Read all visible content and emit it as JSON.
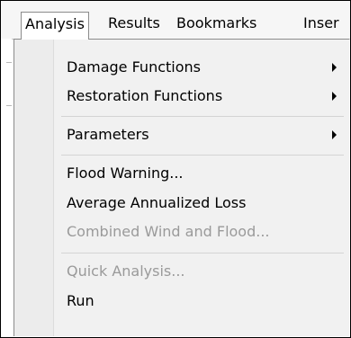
{
  "menubar": {
    "items": [
      {
        "label": "Analysis"
      },
      {
        "label": "Results"
      },
      {
        "label": "Bookmarks"
      },
      {
        "label": "Inser"
      }
    ]
  },
  "dropdown": {
    "items": [
      {
        "label": "Damage Functions",
        "submenu": true,
        "enabled": true
      },
      {
        "label": "Restoration Functions",
        "submenu": true,
        "enabled": true
      },
      {
        "label": "Parameters",
        "submenu": true,
        "enabled": true
      },
      {
        "label": "Flood Warning...",
        "submenu": false,
        "enabled": true
      },
      {
        "label": "Average Annualized Loss",
        "submenu": false,
        "enabled": true
      },
      {
        "label": "Combined Wind and Flood...",
        "submenu": false,
        "enabled": false
      },
      {
        "label": "Quick Analysis...",
        "submenu": false,
        "enabled": false
      },
      {
        "label": "Run",
        "submenu": false,
        "enabled": true
      }
    ]
  },
  "colors": {
    "menubar_bg": "#f6f6f6",
    "dropdown_bg": "#f1f1f1",
    "disabled_text": "#9a9a9a",
    "border": "#8c8c8c"
  }
}
